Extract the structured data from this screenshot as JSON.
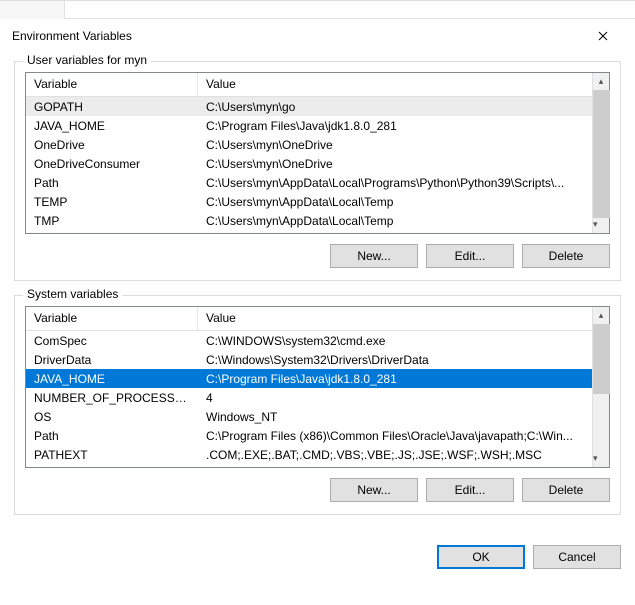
{
  "window": {
    "title": "Environment Variables"
  },
  "user_section": {
    "legend": "User variables for myn",
    "headers": {
      "variable": "Variable",
      "value": "Value"
    },
    "rows": [
      {
        "name": "GOPATH",
        "value": "C:\\Users\\myn\\go"
      },
      {
        "name": "JAVA_HOME",
        "value": "C:\\Program Files\\Java\\jdk1.8.0_281"
      },
      {
        "name": "OneDrive",
        "value": "C:\\Users\\myn\\OneDrive"
      },
      {
        "name": "OneDriveConsumer",
        "value": "C:\\Users\\myn\\OneDrive"
      },
      {
        "name": "Path",
        "value": "C:\\Users\\myn\\AppData\\Local\\Programs\\Python\\Python39\\Scripts\\..."
      },
      {
        "name": "TEMP",
        "value": "C:\\Users\\myn\\AppData\\Local\\Temp"
      },
      {
        "name": "TMP",
        "value": "C:\\Users\\myn\\AppData\\Local\\Temp"
      }
    ],
    "buttons": {
      "new": "New...",
      "edit": "Edit...",
      "delete": "Delete"
    }
  },
  "system_section": {
    "legend": "System variables",
    "headers": {
      "variable": "Variable",
      "value": "Value"
    },
    "rows": [
      {
        "name": "ComSpec",
        "value": "C:\\WINDOWS\\system32\\cmd.exe"
      },
      {
        "name": "DriverData",
        "value": "C:\\Windows\\System32\\Drivers\\DriverData"
      },
      {
        "name": "JAVA_HOME",
        "value": "C:\\Program Files\\Java\\jdk1.8.0_281"
      },
      {
        "name": "NUMBER_OF_PROCESSORS",
        "value": "4"
      },
      {
        "name": "OS",
        "value": "Windows_NT"
      },
      {
        "name": "Path",
        "value": "C:\\Program Files (x86)\\Common Files\\Oracle\\Java\\javapath;C:\\Win..."
      },
      {
        "name": "PATHEXT",
        "value": ".COM;.EXE;.BAT;.CMD;.VBS;.VBE;.JS;.JSE;.WSF;.WSH;.MSC"
      }
    ],
    "selected_index": 2,
    "buttons": {
      "new": "New...",
      "edit": "Edit...",
      "delete": "Delete"
    }
  },
  "footer": {
    "ok": "OK",
    "cancel": "Cancel"
  }
}
